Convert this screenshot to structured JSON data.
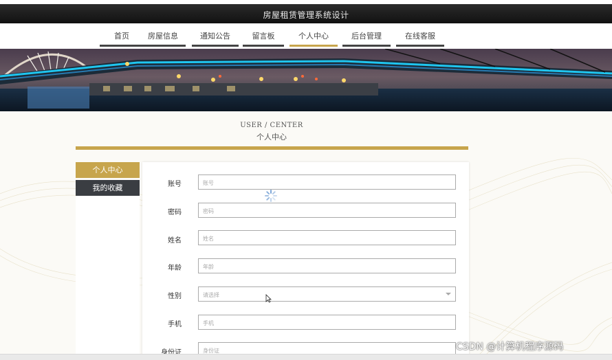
{
  "header": {
    "title": "房屋租赁管理系统设计"
  },
  "nav": {
    "items": [
      {
        "label": "首页"
      },
      {
        "label": "房屋信息"
      },
      {
        "label": "通知公告"
      },
      {
        "label": "留言板"
      },
      {
        "label": "个人中心"
      },
      {
        "label": "后台管理"
      },
      {
        "label": "在线客服"
      }
    ],
    "active": "个人中心"
  },
  "section": {
    "title_en": "USER / CENTER",
    "title_cn": "个人中心"
  },
  "sidebar": {
    "items": [
      {
        "label": "个人中心"
      },
      {
        "label": "我的收藏"
      }
    ]
  },
  "form": {
    "fields": [
      {
        "label": "账号",
        "placeholder": "账号"
      },
      {
        "label": "密码",
        "placeholder": "密码"
      },
      {
        "label": "姓名",
        "placeholder": "姓名"
      },
      {
        "label": "年龄",
        "placeholder": "年龄"
      },
      {
        "label": "性别",
        "placeholder": "请选择"
      },
      {
        "label": "手机",
        "placeholder": "手机"
      },
      {
        "label": "身份证",
        "placeholder": "身份证"
      }
    ]
  },
  "watermark": "CSDN @计算机程序源码",
  "colors": {
    "accent": "#c7a54c",
    "dark": "#3a3d42"
  }
}
